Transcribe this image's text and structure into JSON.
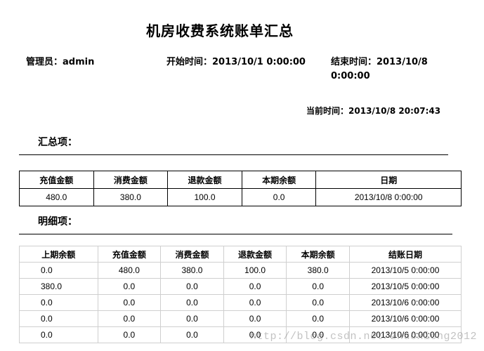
{
  "title": "机房收费系统账单汇总",
  "meta": {
    "admin_label": "管理员：",
    "admin_value": "admin",
    "start_label": "开始时间：",
    "start_value": "2013/10/1 0:00:00",
    "end_label": "结束时间：",
    "end_value_line1": "2013/10/8",
    "end_value_line2": "0:00:00",
    "current_label": "当前时间：",
    "current_value": "2013/10/8 20:07:43"
  },
  "summary": {
    "label": "汇总项：",
    "headers": [
      "充值金额",
      "消费金额",
      "退款金额",
      "本期余额",
      "日期"
    ],
    "row": [
      "480.0",
      "380.0",
      "100.0",
      "0.0",
      "2013/10/8 0:00:00"
    ]
  },
  "detail": {
    "label": "明细项：",
    "headers": [
      "上期余额",
      "充值金额",
      "消费金额",
      "退款金额",
      "本期余额",
      "结账日期"
    ],
    "rows": [
      [
        "0.0",
        "480.0",
        "380.0",
        "100.0",
        "380.0",
        "2013/10/5 0:00:00"
      ],
      [
        "380.0",
        "0.0",
        "0.0",
        "0.0",
        "0.0",
        "2013/10/5 0:00:00"
      ],
      [
        "0.0",
        "0.0",
        "0.0",
        "0.0",
        "0.0",
        "2013/10/6 0:00:00"
      ],
      [
        "0.0",
        "0.0",
        "0.0",
        "0.0",
        "0.0",
        "2013/10/6 0:00:00"
      ],
      [
        "0.0",
        "0.0",
        "0.0",
        "0.0",
        "0.0",
        "2013/10/6 0:00:00"
      ]
    ]
  },
  "watermark": "http://blog.csdn.net/zhuoxiong2012"
}
